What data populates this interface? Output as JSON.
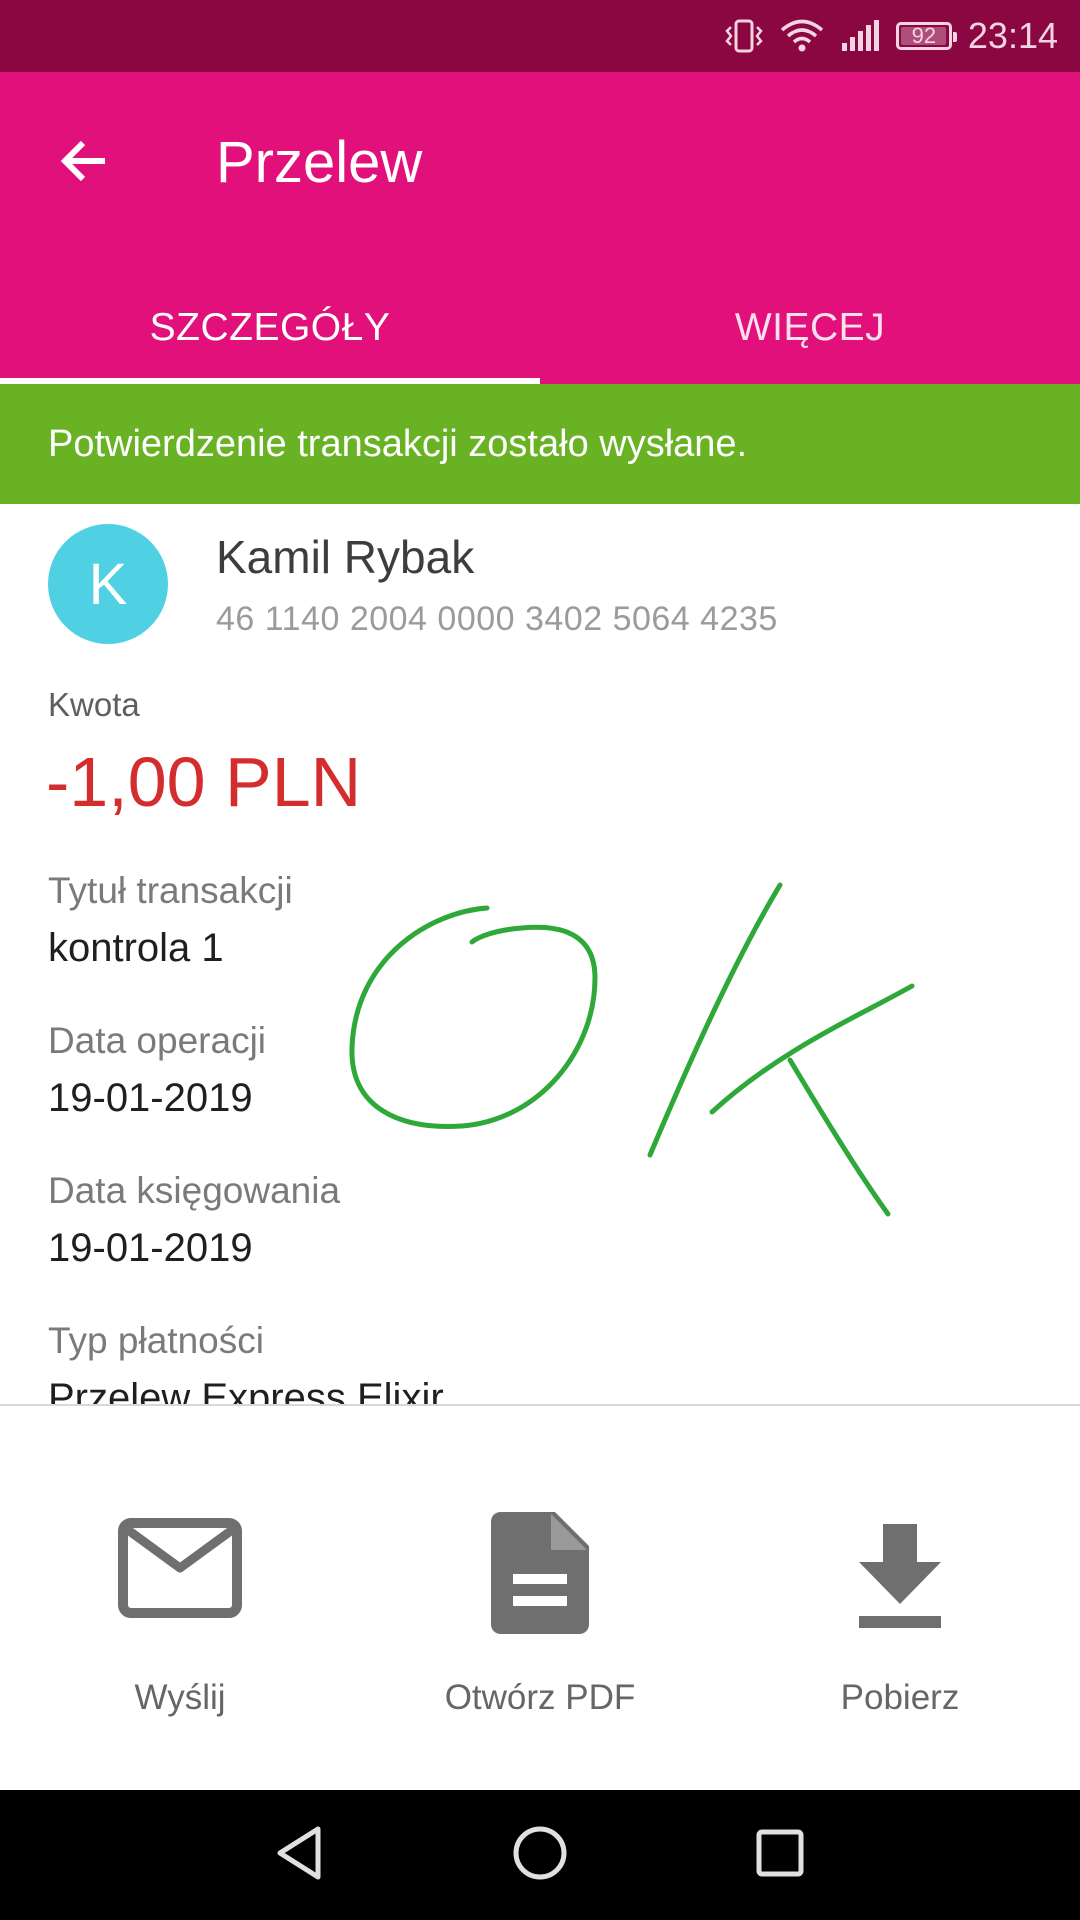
{
  "status_bar": {
    "time": "23:14",
    "battery": "92",
    "icons": [
      "vibrate-icon",
      "wifi-icon",
      "signal-icon",
      "battery-icon"
    ]
  },
  "app_bar": {
    "title": "Przelew",
    "back_icon": "arrow-back-icon",
    "tabs": [
      {
        "label": "SZCZEGÓŁY",
        "active": true
      },
      {
        "label": "WIĘCEJ",
        "active": false
      }
    ]
  },
  "banner": {
    "message": "Potwierdzenie transakcji zostało wysłane.",
    "color": "#68b224"
  },
  "recipient": {
    "initial": "K",
    "name": "Kamil Rybak",
    "account": "46 1140 2004 0000 3402 5064 4235"
  },
  "details": {
    "amount_label": "Kwota",
    "amount_value": "-1,00 PLN",
    "title_label": "Tytuł transakcji",
    "title_value": "kontrola 1",
    "op_date_label": "Data operacji",
    "op_date_value": "19-01-2019",
    "book_date_label": "Data księgowania",
    "book_date_value": "19-01-2019",
    "payment_type_label": "Typ płatności",
    "payment_type_value": "Przelew Express Elixir"
  },
  "handwriting": {
    "text": "OK",
    "color": "#2fa83a"
  },
  "actions": [
    {
      "label": "Wyślij",
      "icon": "mail-icon"
    },
    {
      "label": "Otwórz PDF",
      "icon": "document-icon"
    },
    {
      "label": "Pobierz",
      "icon": "download-icon"
    }
  ],
  "nav_bar": {
    "icons": [
      "nav-back-icon",
      "nav-home-icon",
      "nav-recents-icon"
    ]
  },
  "colors": {
    "status_bar": "#8a0742",
    "app_bar": "#e2107a",
    "amount": "#d32d2d",
    "avatar": "#4fd1e3"
  }
}
